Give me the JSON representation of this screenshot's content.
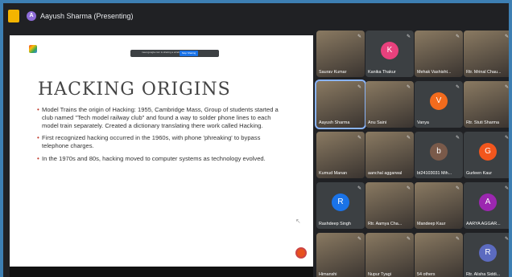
{
  "header": {
    "presenter_initial": "A",
    "presenter_label": "Aayush Sharma (Presenting)"
  },
  "share_bar": {
    "text": "meet.google.com is sharing a window.",
    "stop_label": "Stop Sharing",
    "hide_label": "Hide"
  },
  "slide": {
    "title": "HACKING ORIGINS",
    "bullets": [
      "Model Trains the origin of Hacking: 1955, Cambridge Mass, Group of students started a club named \"Tech model railway club\" and found a way to solder phone lines to each model train separately. Created a dictionary translating there work called Hacking.",
      "First recognized hacking occurred in the 1960s, with phone 'phreaking' to bypass telephone charges.",
      "In the 1970s and 80s, hacking moved to computer systems as technology evolved."
    ]
  },
  "participants": [
    {
      "name": "Saurav Kumar",
      "initial": "",
      "color": "",
      "photo": true
    },
    {
      "name": "Kanika Thakur",
      "initial": "K",
      "color": "#e8417d",
      "photo": false
    },
    {
      "name": "Mehak Vashisht...",
      "initial": "",
      "color": "",
      "photo": true
    },
    {
      "name": "Rtr. Mrinal Chau...",
      "initial": "",
      "color": "",
      "photo": true
    },
    {
      "name": "Aayush Sharma",
      "initial": "",
      "color": "",
      "photo": true
    },
    {
      "name": "Anu Saini",
      "initial": "",
      "color": "",
      "photo": true
    },
    {
      "name": "Vanya",
      "initial": "V",
      "color": "#f26b1d",
      "photo": false
    },
    {
      "name": "Rtr. Stuti Sharma",
      "initial": "",
      "color": "",
      "photo": true
    },
    {
      "name": "Kumud Manan",
      "initial": "",
      "color": "",
      "photo": true
    },
    {
      "name": "aanchal aggarwal",
      "initial": "",
      "color": "",
      "photo": true
    },
    {
      "name": "bt24103031 Mih...",
      "initial": "b",
      "color": "#7a5a4a",
      "photo": false
    },
    {
      "name": "Gurleen Kaur",
      "initial": "G",
      "color": "#f2561d",
      "photo": false
    },
    {
      "name": "Rashdeep Singh",
      "initial": "R",
      "color": "#1a73e8",
      "photo": false
    },
    {
      "name": "Rtr. Aamya Cha...",
      "initial": "",
      "color": "",
      "photo": true
    },
    {
      "name": "Mandeep Kaur",
      "initial": "",
      "color": "",
      "photo": true
    },
    {
      "name": "AARYA AGGAR...",
      "initial": "A",
      "color": "#9c27b0",
      "photo": false
    },
    {
      "name": "Himanshi",
      "initial": "",
      "color": "",
      "photo": true
    },
    {
      "name": "Nupur Tyagi",
      "initial": "",
      "color": "",
      "photo": true
    },
    {
      "name": "54 others",
      "initial": "",
      "color": "",
      "photo": true
    },
    {
      "name": "Rtr. Alisha Siddi...",
      "initial": "R",
      "color": "#5c6bc0",
      "photo": false
    }
  ]
}
